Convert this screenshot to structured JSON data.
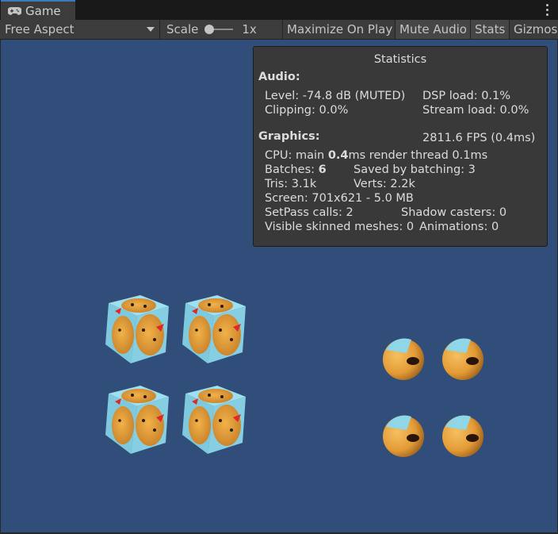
{
  "tab": {
    "label": "Game",
    "icon": "gamepad-icon"
  },
  "toolbar": {
    "aspect": "Free Aspect",
    "scale_label": "Scale",
    "scale_value": "1x",
    "scale_level": 0,
    "maximize": "Maximize On Play",
    "mute": "Mute Audio",
    "stats": "Stats",
    "gizmos": "Gizmos"
  },
  "stats": {
    "title": "Statistics",
    "audio_head": "Audio:",
    "level": "Level: -74.8 dB (MUTED)",
    "dsp": "DSP load: 0.1%",
    "clipping": "Clipping: 0.0%",
    "stream": "Stream load: 0.0%",
    "graphics_head": "Graphics:",
    "fps": "2811.6 FPS (0.4ms)",
    "cpu_prefix": "CPU: main ",
    "cpu_main": "0.4",
    "cpu_suffix": "ms  render thread 0.1ms",
    "batches_prefix": "Batches: ",
    "batches": "6",
    "saved": "Saved by batching: 3",
    "tris": "Tris: 3.1k",
    "verts": "Verts: 2.2k",
    "screen": "Screen: 701x621 - 5.0 MB",
    "setpass": "SetPass calls: 2",
    "shadow": "Shadow casters: 0",
    "skinned": "Visible skinned meshes: 0",
    "animations": "Animations: 0"
  },
  "colors": {
    "viewport_bg": "#314d79",
    "cube_face": "#8fd6e8",
    "chick": "#e8a03a",
    "beak": "#e0282a"
  }
}
